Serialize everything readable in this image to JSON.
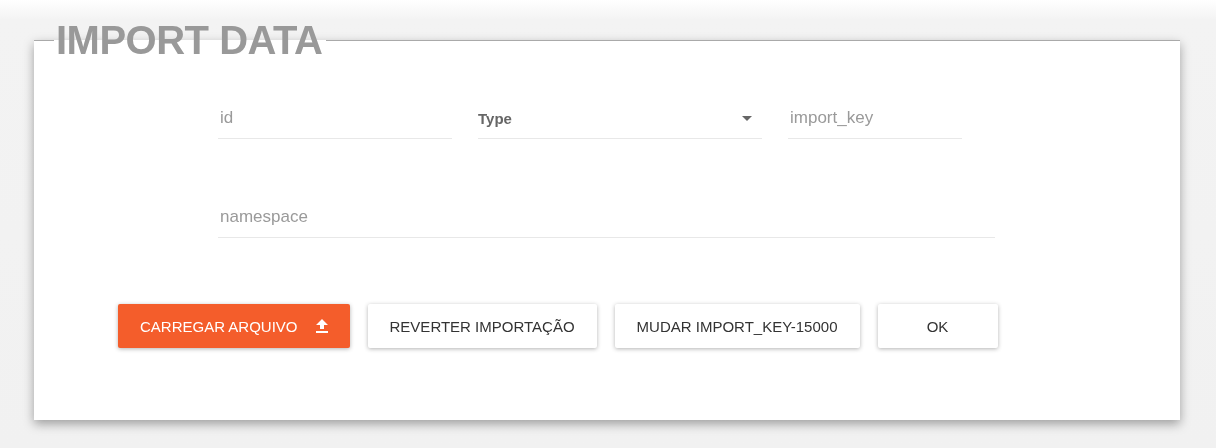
{
  "title": "IMPORT DATA",
  "fields": [
    {
      "kind": "text",
      "placeholder": "id"
    },
    {
      "kind": "select",
      "label": "Type"
    },
    {
      "kind": "text",
      "placeholder": "import_key"
    }
  ],
  "namespace": {
    "placeholder": "namespace"
  },
  "buttons": [
    {
      "label": "CARREGAR ARQUIVO",
      "kind": "primary"
    },
    {
      "label": "REVERTER IMPORTAÇÃO",
      "kind": "plain"
    },
    {
      "label": "MUDAR IMPORT_KEY-15000",
      "kind": "plain"
    },
    {
      "label": "OK",
      "kind": "plain"
    }
  ]
}
